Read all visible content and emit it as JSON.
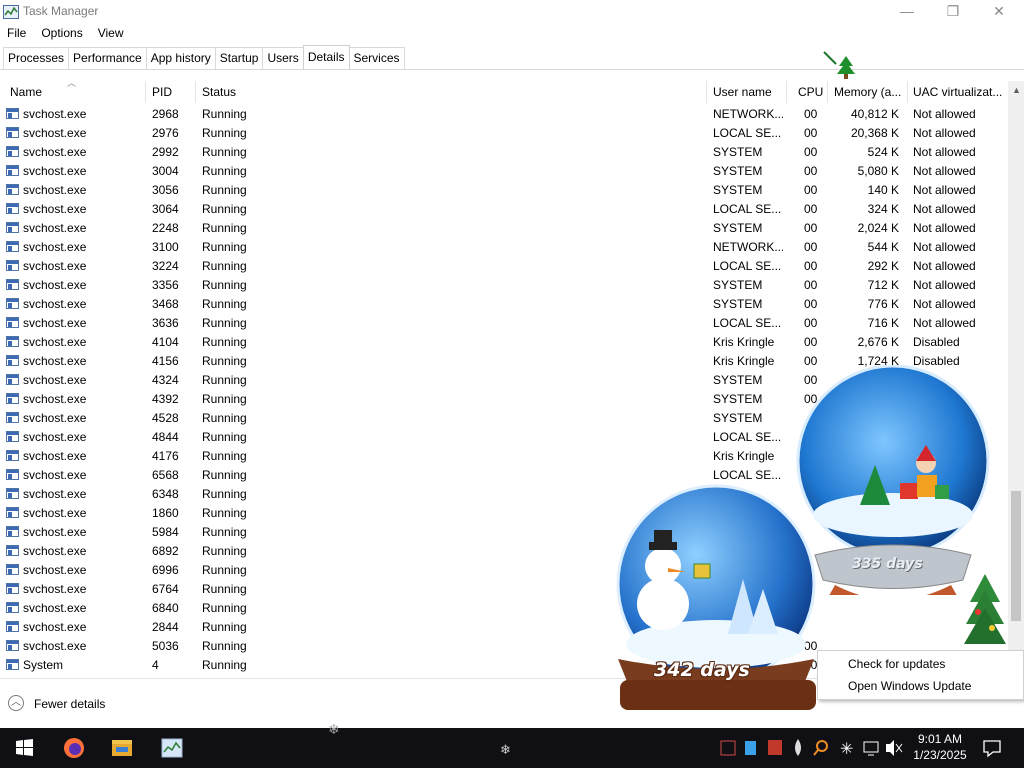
{
  "window": {
    "title": "Task Manager",
    "controls": {
      "minimize": "—",
      "maximize": "❐",
      "close": "✕"
    }
  },
  "menu": [
    "File",
    "Options",
    "View"
  ],
  "tabs": [
    "Processes",
    "Performance",
    "App history",
    "Startup",
    "Users",
    "Details",
    "Services"
  ],
  "active_tab": "Details",
  "columns": {
    "name": "Name",
    "pid": "PID",
    "status": "Status",
    "user": "User name",
    "cpu": "CPU",
    "memory": "Memory (a...",
    "uac": "UAC virtualizat..."
  },
  "rows": [
    {
      "name": "svchost.exe",
      "pid": "2968",
      "status": "Running",
      "user": "NETWORK...",
      "cpu": "00",
      "memory": "40,812 K",
      "uac": "Not allowed"
    },
    {
      "name": "svchost.exe",
      "pid": "2976",
      "status": "Running",
      "user": "LOCAL SE...",
      "cpu": "00",
      "memory": "20,368 K",
      "uac": "Not allowed"
    },
    {
      "name": "svchost.exe",
      "pid": "2992",
      "status": "Running",
      "user": "SYSTEM",
      "cpu": "00",
      "memory": "524 K",
      "uac": "Not allowed"
    },
    {
      "name": "svchost.exe",
      "pid": "3004",
      "status": "Running",
      "user": "SYSTEM",
      "cpu": "00",
      "memory": "5,080 K",
      "uac": "Not allowed"
    },
    {
      "name": "svchost.exe",
      "pid": "3056",
      "status": "Running",
      "user": "SYSTEM",
      "cpu": "00",
      "memory": "140 K",
      "uac": "Not allowed"
    },
    {
      "name": "svchost.exe",
      "pid": "3064",
      "status": "Running",
      "user": "LOCAL SE...",
      "cpu": "00",
      "memory": "324 K",
      "uac": "Not allowed"
    },
    {
      "name": "svchost.exe",
      "pid": "2248",
      "status": "Running",
      "user": "SYSTEM",
      "cpu": "00",
      "memory": "2,024 K",
      "uac": "Not allowed"
    },
    {
      "name": "svchost.exe",
      "pid": "3100",
      "status": "Running",
      "user": "NETWORK...",
      "cpu": "00",
      "memory": "544 K",
      "uac": "Not allowed"
    },
    {
      "name": "svchost.exe",
      "pid": "3224",
      "status": "Running",
      "user": "LOCAL SE...",
      "cpu": "00",
      "memory": "292 K",
      "uac": "Not allowed"
    },
    {
      "name": "svchost.exe",
      "pid": "3356",
      "status": "Running",
      "user": "SYSTEM",
      "cpu": "00",
      "memory": "712 K",
      "uac": "Not allowed"
    },
    {
      "name": "svchost.exe",
      "pid": "3468",
      "status": "Running",
      "user": "SYSTEM",
      "cpu": "00",
      "memory": "776 K",
      "uac": "Not allowed"
    },
    {
      "name": "svchost.exe",
      "pid": "3636",
      "status": "Running",
      "user": "LOCAL SE...",
      "cpu": "00",
      "memory": "716 K",
      "uac": "Not allowed"
    },
    {
      "name": "svchost.exe",
      "pid": "4104",
      "status": "Running",
      "user": "Kris Kringle",
      "cpu": "00",
      "memory": "2,676 K",
      "uac": "Disabled"
    },
    {
      "name": "svchost.exe",
      "pid": "4156",
      "status": "Running",
      "user": "Kris Kringle",
      "cpu": "00",
      "memory": "1,724 K",
      "uac": "Disabled"
    },
    {
      "name": "svchost.exe",
      "pid": "4324",
      "status": "Running",
      "user": "SYSTEM",
      "cpu": "00",
      "memory": "",
      "uac": ""
    },
    {
      "name": "svchost.exe",
      "pid": "4392",
      "status": "Running",
      "user": "SYSTEM",
      "cpu": "00",
      "memory": "",
      "uac": ""
    },
    {
      "name": "svchost.exe",
      "pid": "4528",
      "status": "Running",
      "user": "SYSTEM",
      "cpu": "",
      "memory": "",
      "uac": ""
    },
    {
      "name": "svchost.exe",
      "pid": "4844",
      "status": "Running",
      "user": "LOCAL SE...",
      "cpu": "",
      "memory": "",
      "uac": ""
    },
    {
      "name": "svchost.exe",
      "pid": "4176",
      "status": "Running",
      "user": "Kris Kringle",
      "cpu": "",
      "memory": "",
      "uac": ""
    },
    {
      "name": "svchost.exe",
      "pid": "6568",
      "status": "Running",
      "user": "LOCAL SE...",
      "cpu": "",
      "memory": "",
      "uac": ""
    },
    {
      "name": "svchost.exe",
      "pid": "6348",
      "status": "Running",
      "user": "",
      "cpu": "",
      "memory": "",
      "uac": ""
    },
    {
      "name": "svchost.exe",
      "pid": "1860",
      "status": "Running",
      "user": "",
      "cpu": "",
      "memory": "",
      "uac": ""
    },
    {
      "name": "svchost.exe",
      "pid": "5984",
      "status": "Running",
      "user": "",
      "cpu": "",
      "memory": "",
      "uac": ""
    },
    {
      "name": "svchost.exe",
      "pid": "6892",
      "status": "Running",
      "user": "",
      "cpu": "",
      "memory": "",
      "uac": ""
    },
    {
      "name": "svchost.exe",
      "pid": "6996",
      "status": "Running",
      "user": "",
      "cpu": "",
      "memory": "",
      "uac": ""
    },
    {
      "name": "svchost.exe",
      "pid": "6764",
      "status": "Running",
      "user": "",
      "cpu": "",
      "memory": "",
      "uac": ""
    },
    {
      "name": "svchost.exe",
      "pid": "6840",
      "status": "Running",
      "user": "",
      "cpu": "",
      "memory": "",
      "uac": ""
    },
    {
      "name": "svchost.exe",
      "pid": "2844",
      "status": "Running",
      "user": "",
      "cpu": "",
      "memory": "",
      "uac": ""
    },
    {
      "name": "svchost.exe",
      "pid": "5036",
      "status": "Running",
      "user": "",
      "cpu": "00",
      "memory": "",
      "uac": ""
    },
    {
      "name": "System",
      "pid": "4",
      "status": "Running",
      "user": "",
      "cpu": "00",
      "memory": "",
      "uac": ""
    }
  ],
  "footer": {
    "fewer_details": "Fewer details"
  },
  "gadgets": {
    "globe_snowman_days": "342 days",
    "globe_presents_days": "335 days"
  },
  "context_menu": [
    "Check for updates",
    "Open Windows Update"
  ],
  "taskbar": {
    "pinned_icons": [
      "windows-start-icon",
      "firefox-icon",
      "file-explorer-icon",
      "task-manager-icon"
    ],
    "tray_icons": [
      "defender-icon",
      "app-icon",
      "network-app-icon",
      "drop-icon",
      "search-app-icon",
      "snowflake-icon",
      "network-icon",
      "volume-muted-icon"
    ],
    "time": "9:01 AM",
    "date": "1/23/2025"
  },
  "colors": {
    "taskbar": "#101014",
    "tab_border": "#d9d9d9",
    "globe_glass": "#2f7fd6",
    "globe_base": "#7a3c1e"
  }
}
